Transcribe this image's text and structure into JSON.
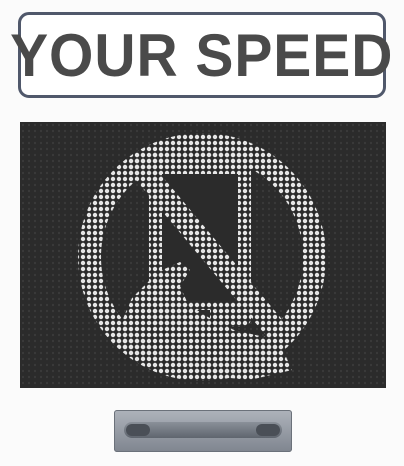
{
  "sign": {
    "title": "YOUR SPEED",
    "display_icon": "no-phone-icon",
    "colors": {
      "frame": "#50586b",
      "title_text": "#4a4a4a",
      "led_background": "#2b2b2b",
      "led_on": "#e6e6e6"
    }
  }
}
